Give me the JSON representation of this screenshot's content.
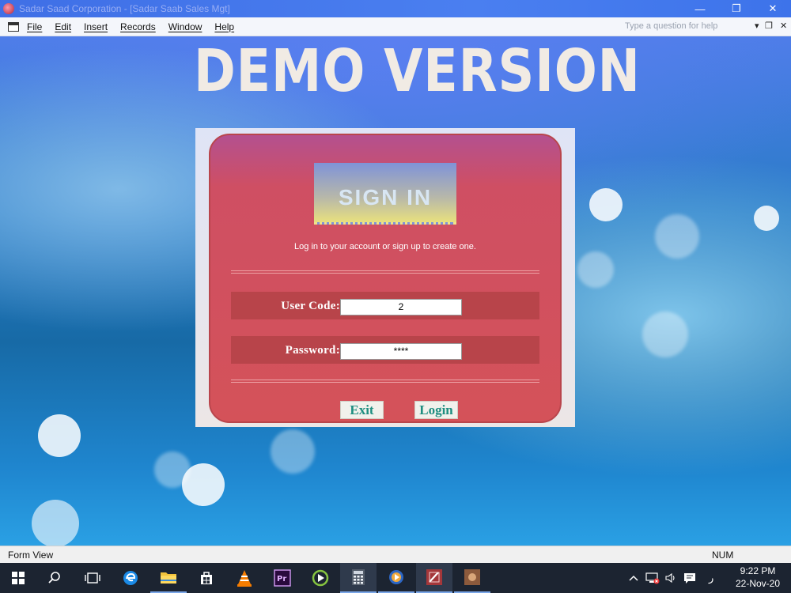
{
  "window": {
    "title": "Sadar Saad Corporation - [Sadar Saab Sales Mgt]",
    "minimize": "—",
    "restore": "❐",
    "close": "✕"
  },
  "menu": {
    "items": [
      "File",
      "Edit",
      "Insert",
      "Records",
      "Window",
      "Help"
    ],
    "help_placeholder": "Type a question for help",
    "dropdown": "▾",
    "restore": "❐",
    "close": "✕"
  },
  "banner": {
    "text": "DEMO VERSION"
  },
  "login": {
    "heading": "SIGN IN",
    "subtitle": "Log in to your account or sign up to create one.",
    "user_code_label": "User Code:",
    "user_code_value": "2",
    "password_label": "Password:",
    "password_value": "****",
    "exit_label": "Exit",
    "login_label": "Login"
  },
  "status": {
    "left": "Form View",
    "right": "NUM"
  },
  "taskbar": {
    "items": [
      "start-icon",
      "search-icon",
      "task-view-icon",
      "edge-icon",
      "file-explorer-icon",
      "store-icon",
      "vlc-icon",
      "premiere-icon",
      "camtasia-icon",
      "calculator-icon",
      "media-player-icon",
      "access-icon",
      "app-icon"
    ],
    "ime": "ر",
    "time": "9:22 PM",
    "date": "22-Nov-20"
  }
}
